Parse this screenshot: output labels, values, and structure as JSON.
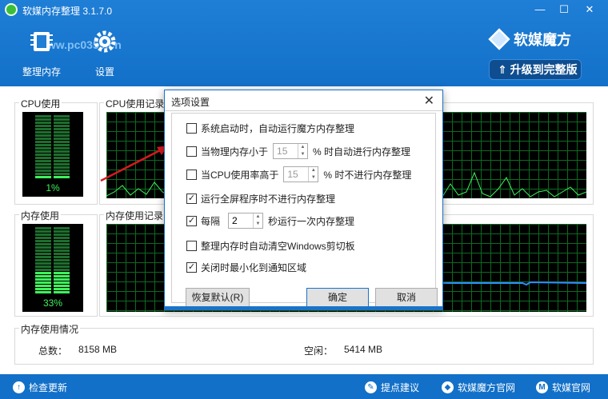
{
  "window": {
    "title": "软媒内存整理 3.1.7.0",
    "minimize": "—",
    "maximize": "☐",
    "close": "✕",
    "watermark": "www.pc0359.cn"
  },
  "toolbar": {
    "cleanup_label": "整理内存",
    "settings_label": "设置"
  },
  "brand": {
    "name": "软媒魔方",
    "upgrade_label": "升级到完整版"
  },
  "cpu": {
    "panel_label": "CPU使用",
    "history_label": "CPU使用记录",
    "percent": "1%",
    "level": 0.01
  },
  "mem": {
    "panel_label": "内存使用",
    "history_label": "内存使用记录",
    "percent": "33%",
    "level": 0.33
  },
  "mem_info": {
    "section_label": "内存使用情况",
    "total_label": "总数：",
    "total_value": "8158 MB",
    "free_label": "空闲：",
    "free_value": "5414 MB"
  },
  "footer": {
    "update": "检查更新",
    "feedback": "提点建议",
    "site1": "软媒魔方官网",
    "site2": "软媒官网"
  },
  "dialog": {
    "title": "选项设置",
    "close": "✕",
    "options": [
      {
        "label": "系统启动时，自动运行魔方内存整理",
        "checked": false
      },
      {
        "prefix": "当物理内存小于",
        "value": "15",
        "suffix": "% 时自动进行内存整理",
        "checked": false
      },
      {
        "prefix": "当CPU使用率高于",
        "value": "15",
        "suffix": "% 时不进行内存整理",
        "checked": false
      },
      {
        "label": "运行全屏程序时不进行内存整理",
        "checked": true
      },
      {
        "prefix": "每隔",
        "value": "2",
        "suffix": "秒运行一次内存整理",
        "checked": true
      },
      {
        "label": "整理内存时自动清空Windows剪切板",
        "checked": false
      },
      {
        "label": "关闭时最小化到通知区域",
        "checked": true
      }
    ],
    "reset_label": "恢复默认(R)",
    "ok_label": "确定",
    "cancel_label": "取消"
  },
  "colors": {
    "header": "#1270c8",
    "accent": "#1a73c9",
    "gauge_on": "#3ef25c",
    "gauge_off": "#1e6e2e",
    "arrow": "#d71920"
  }
}
